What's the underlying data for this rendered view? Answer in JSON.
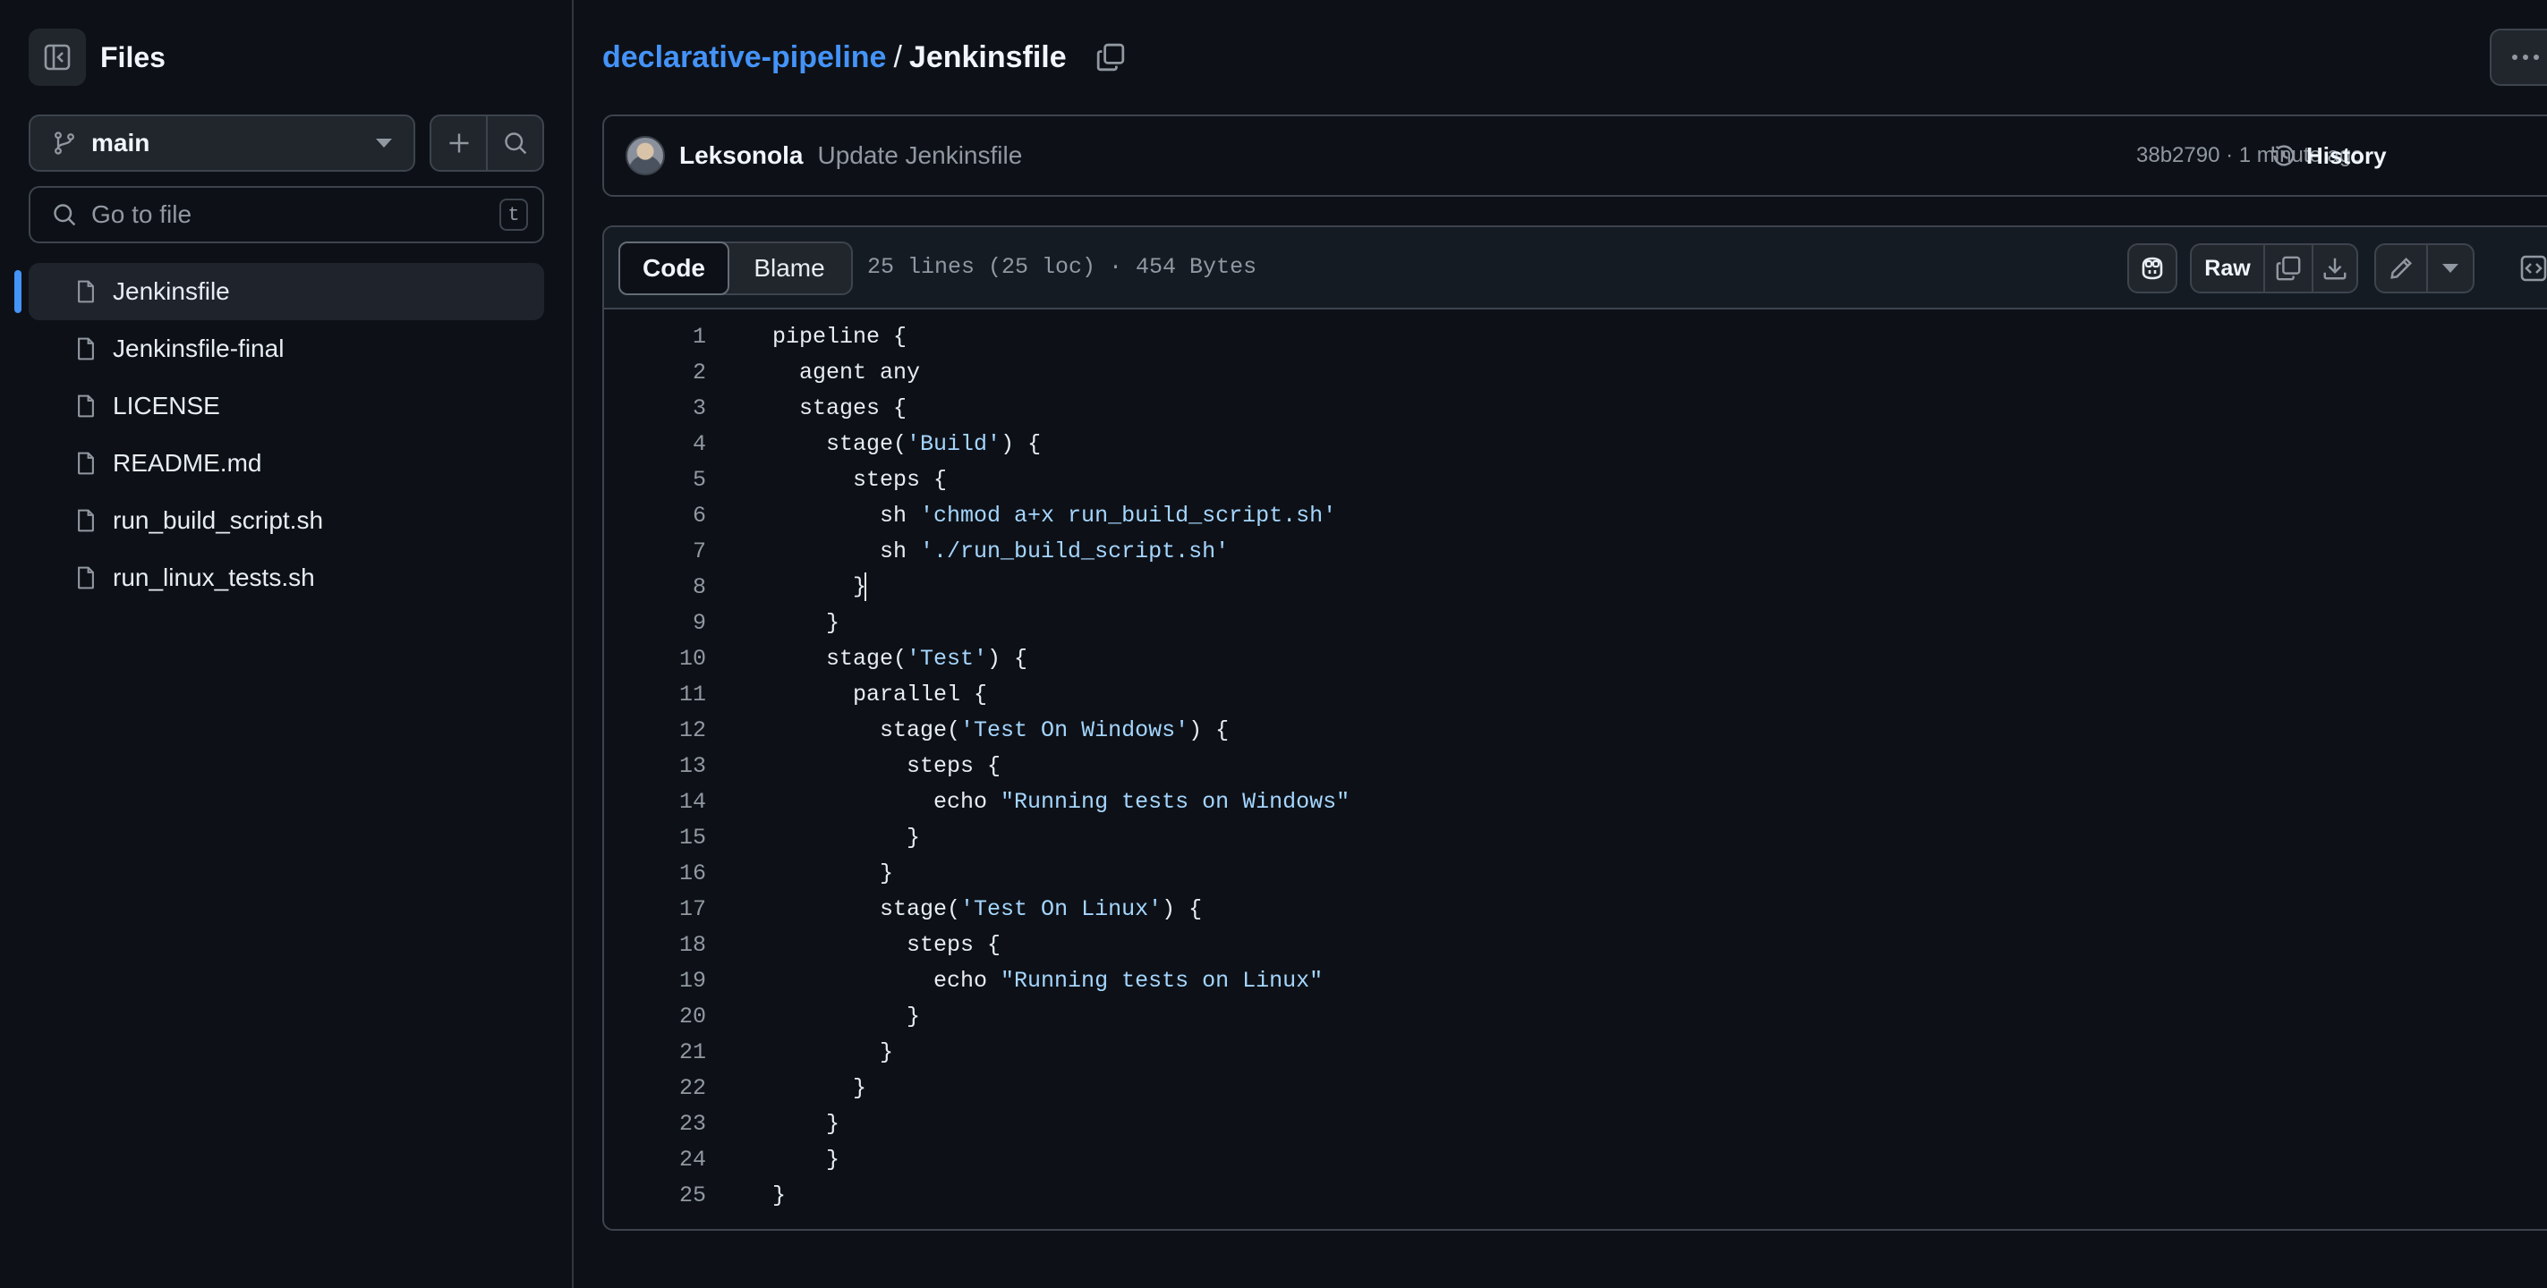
{
  "sidebar": {
    "title": "Files",
    "branch": "main",
    "search_placeholder": "Go to file",
    "search_shortcut": "t",
    "files": [
      {
        "name": "Jenkinsfile",
        "active": true
      },
      {
        "name": "Jenkinsfile-final",
        "active": false
      },
      {
        "name": "LICENSE",
        "active": false
      },
      {
        "name": "README.md",
        "active": false
      },
      {
        "name": "run_build_script.sh",
        "active": false
      },
      {
        "name": "run_linux_tests.sh",
        "active": false
      }
    ]
  },
  "breadcrumb": {
    "repo": "declarative-pipeline",
    "separator": "/",
    "file": "Jenkinsfile"
  },
  "commit": {
    "author": "Leksonola",
    "message": "Update Jenkinsfile",
    "meta": "38b2790 · 1 minute ago",
    "history_label": "History"
  },
  "file_view": {
    "tabs": {
      "code": "Code",
      "blame": "Blame"
    },
    "active_tab": "Code",
    "info": "25 lines (25 loc) · 454 Bytes",
    "raw_label": "Raw"
  },
  "code_lines": [
    "pipeline {",
    "  agent any",
    "  stages {",
    "    stage('Build') {",
    "      steps {",
    "        sh 'chmod a+x run_build_script.sh'",
    "        sh './run_build_script.sh'",
    "      }",
    "    }",
    "    stage('Test') {",
    "      parallel {",
    "        stage('Test On Windows') {",
    "          steps {",
    "            echo \"Running tests on Windows\"",
    "          }",
    "        }",
    "        stage('Test On Linux') {",
    "          steps {",
    "            echo \"Running tests on Linux\"",
    "          }",
    "        }",
    "      }",
    "    }",
    "    }",
    "}"
  ],
  "cursor_line": 8,
  "colors": {
    "background": "#0d1117",
    "accent": "#4493f8",
    "string": "#a5d6ff",
    "muted": "#9198a1"
  },
  "icons": {
    "collapse": "sidebar-collapse-icon",
    "branch": "git-branch-icon",
    "add": "plus-icon",
    "search": "search-icon",
    "file": "file-icon",
    "copy": "copy-icon",
    "history": "history-icon",
    "copilot": "copilot-icon",
    "download": "download-icon",
    "edit": "pencil-icon",
    "symbols": "code-square-icon",
    "more": "kebab-horizontal-icon"
  }
}
